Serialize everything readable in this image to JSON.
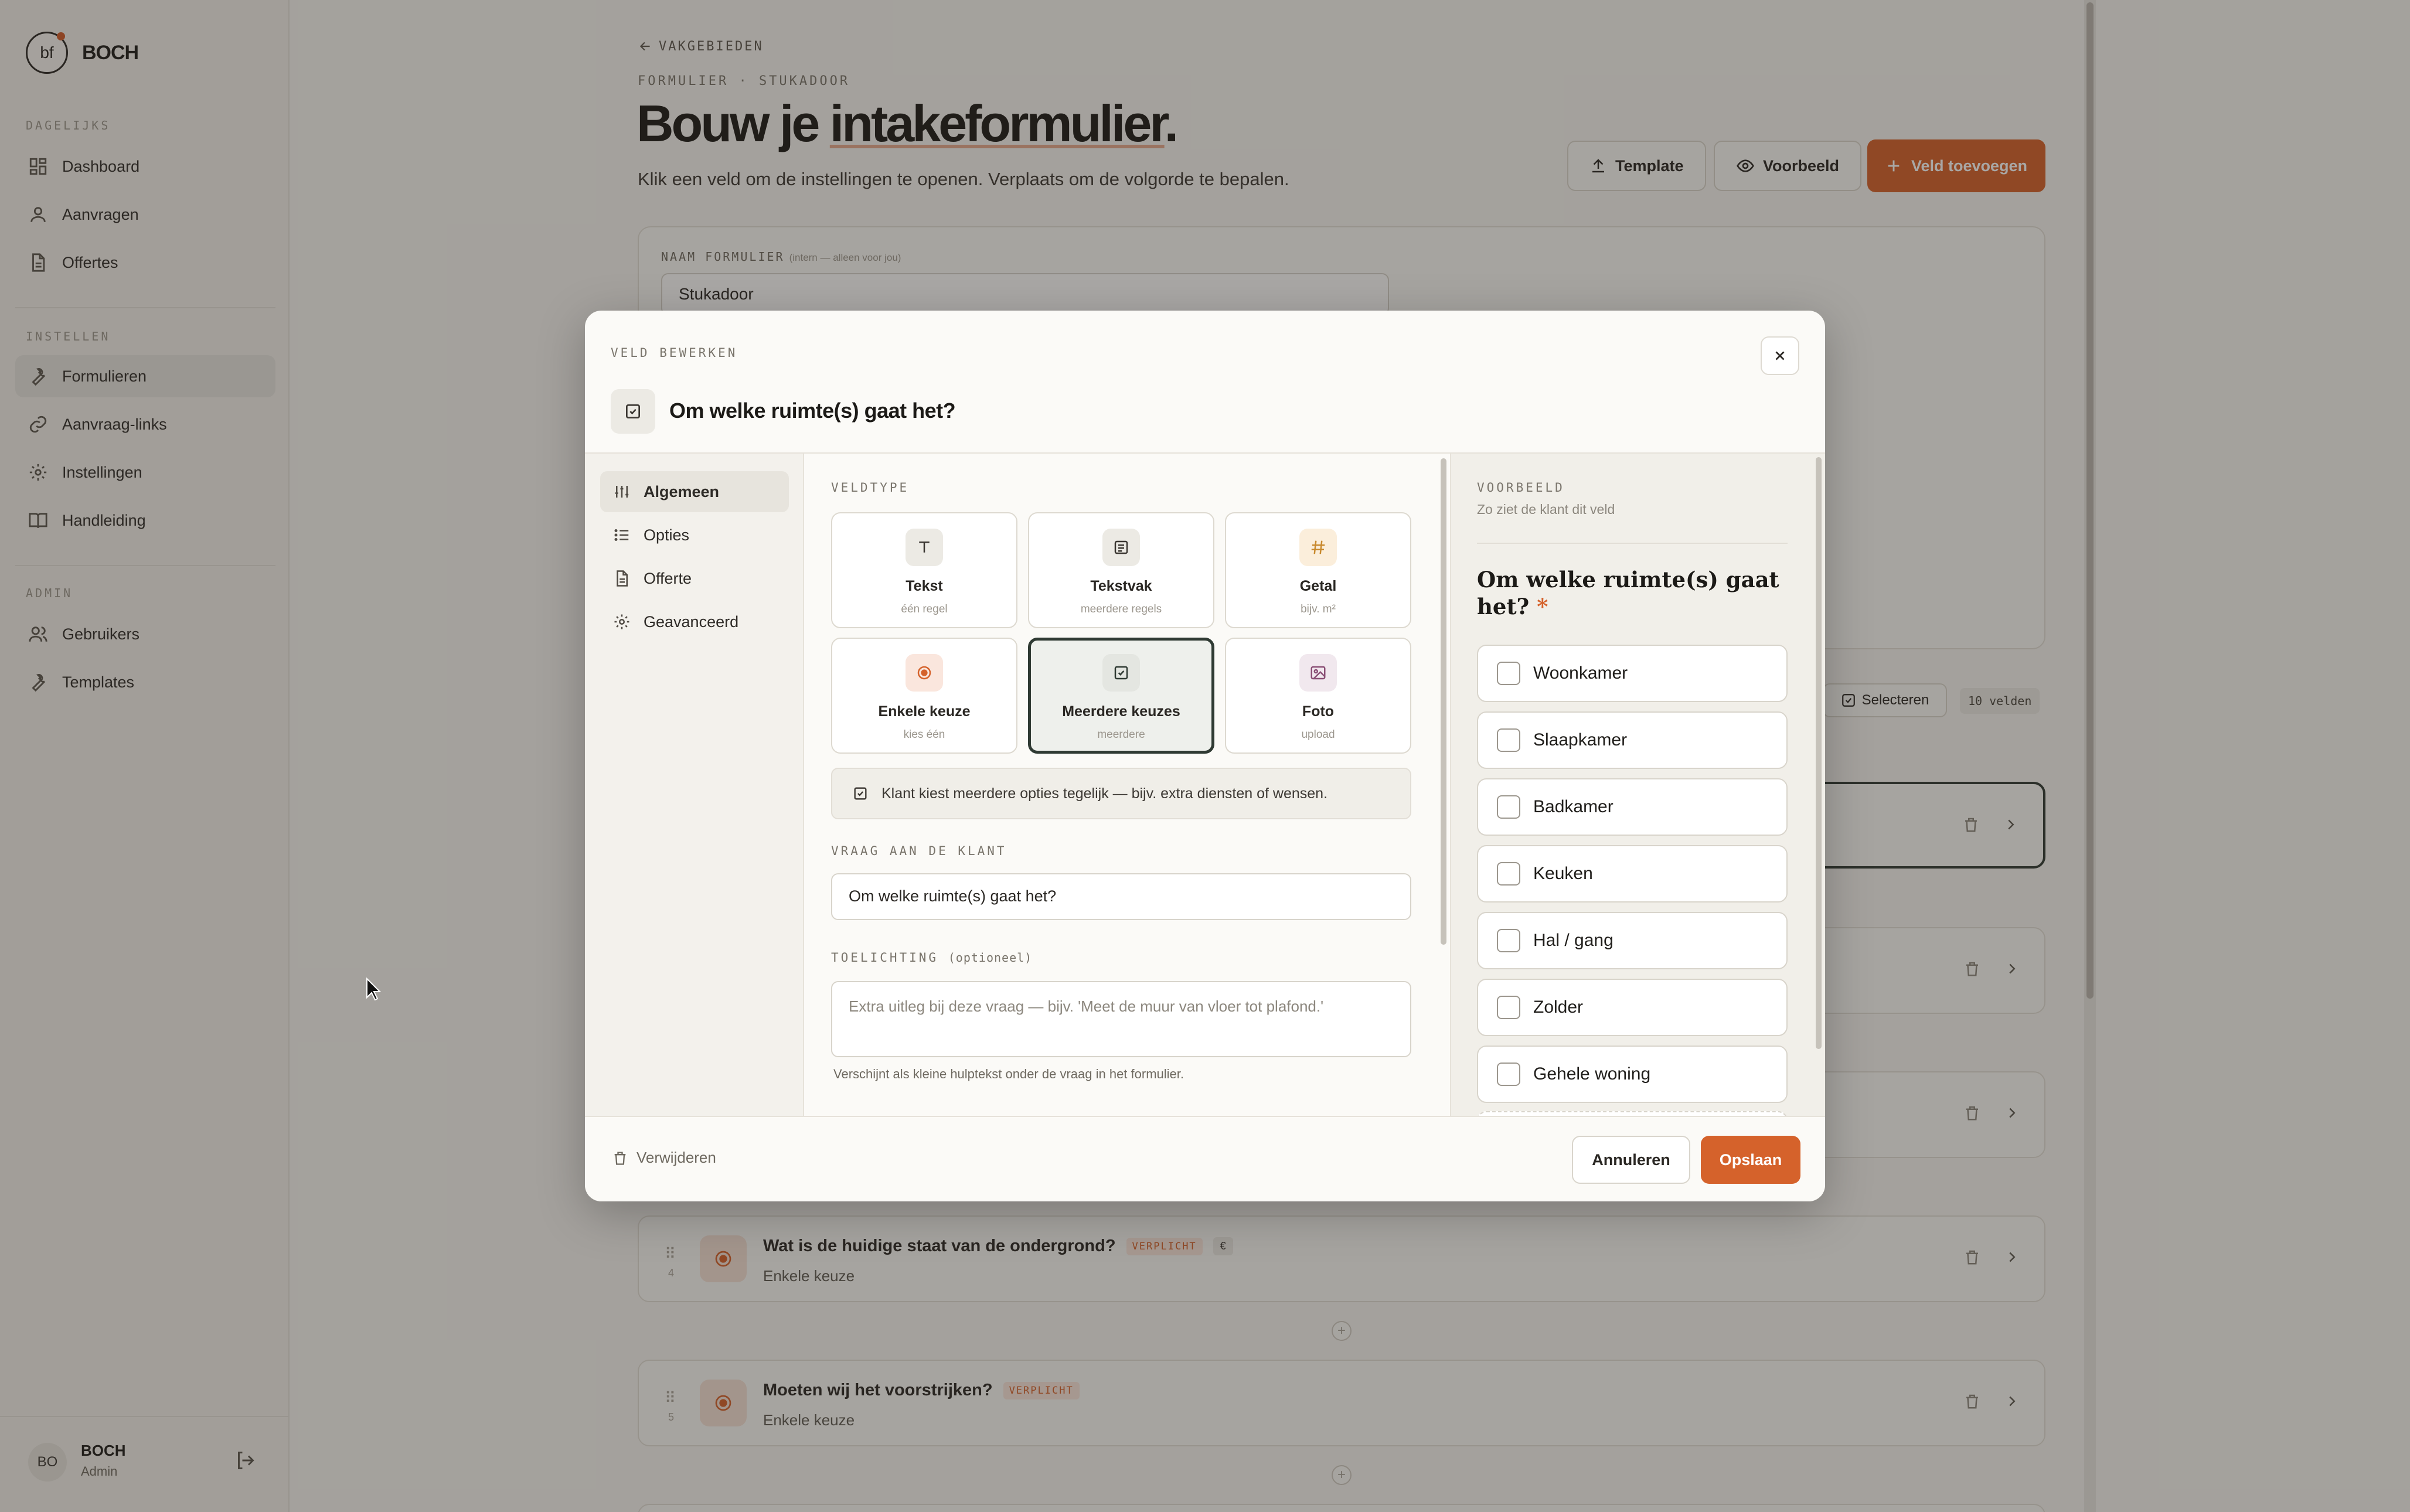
{
  "app": {
    "logo_text": "bf",
    "brand": "BOCH"
  },
  "sidebar": {
    "sections": [
      {
        "label": "DAGELIJKS",
        "items": [
          {
            "label": "Dashboard",
            "icon": "grid-icon"
          },
          {
            "label": "Aanvragen",
            "icon": "user-icon"
          },
          {
            "label": "Offertes",
            "icon": "document-icon"
          }
        ]
      },
      {
        "label": "INSTELLEN",
        "items": [
          {
            "label": "Formulieren",
            "icon": "wrench-icon",
            "active": true
          },
          {
            "label": "Aanvraag-links",
            "icon": "link-icon"
          },
          {
            "label": "Instellingen",
            "icon": "gear-icon"
          },
          {
            "label": "Handleiding",
            "icon": "book-icon"
          }
        ]
      },
      {
        "label": "ADMIN",
        "items": [
          {
            "label": "Gebruikers",
            "icon": "users-icon"
          },
          {
            "label": "Templates",
            "icon": "wrench-icon"
          }
        ]
      }
    ],
    "user": {
      "initials": "BO",
      "name": "BOCH",
      "role": "Admin"
    }
  },
  "header": {
    "back_label": "VAKGEBIEDEN",
    "breadcrumb": "FORMULIER · STUKADOOR",
    "title_part1": "Bouw je ",
    "title_part2": "intakeformulier",
    "title_part3": ".",
    "subtitle": "Klik een veld om de instellingen te openen. Verplaats om de volgorde te bepalen.",
    "template_btn": "Template",
    "preview_btn": "Voorbeeld",
    "add_field_btn": "Veld toevoegen"
  },
  "form_meta": {
    "name_label": "NAAM FORMULIER",
    "name_hint": "(intern — alleen voor jou)",
    "name_value": "Stukadoor",
    "select_btn": "Selecteren",
    "field_count": "10 velden"
  },
  "rows": [
    {
      "num": "4",
      "title": "Wat is de huidige staat van de ondergrond?",
      "badge": "VERPLICHT",
      "currency": "€",
      "type": "Enkele keuze"
    },
    {
      "num": "5",
      "title": "Moeten wij het voorstrijken?",
      "badge": "VERPLICHT",
      "type": "Enkele keuze"
    }
  ],
  "modal": {
    "eyebrow": "VELD BEWERKEN",
    "title": "Om welke ruimte(s) gaat het?",
    "tabs": [
      {
        "label": "Algemeen",
        "icon": "sliders-icon",
        "active": true
      },
      {
        "label": "Opties",
        "icon": "list-icon"
      },
      {
        "label": "Offerte",
        "icon": "document-icon"
      },
      {
        "label": "Geavanceerd",
        "icon": "gear-icon"
      }
    ],
    "fieldtype_label": "VELDTYPE",
    "field_types": [
      {
        "name": "Tekst",
        "sub": "één regel",
        "icon": "text-icon",
        "color": "#eceae4"
      },
      {
        "name": "Tekstvak",
        "sub": "meerdere regels",
        "icon": "textarea-icon",
        "color": "#eceae4"
      },
      {
        "name": "Getal",
        "sub": "bijv. m²",
        "icon": "hash-icon",
        "color": "#fbeedb"
      },
      {
        "name": "Enkele keuze",
        "sub": "kies één",
        "icon": "radio-icon",
        "color": "#fae6dd"
      },
      {
        "name": "Meerdere keuzes",
        "sub": "meerdere",
        "icon": "checkbox-icon",
        "color": "#eceae4",
        "selected": true
      },
      {
        "name": "Foto",
        "sub": "upload",
        "icon": "image-icon",
        "color": "#f1e8ee"
      }
    ],
    "type_info": "Klant kiest meerdere opties tegelijk — bijv. extra diensten of wensen.",
    "question_label": "VRAAG AAN DE KLANT",
    "question_value": "Om welke ruimte(s) gaat het?",
    "explain_label": "TOELICHTING",
    "explain_optional": "(optioneel)",
    "explain_placeholder": "Extra uitleg bij deze vraag — bijv. 'Meet de muur van vloer tot plafond.'",
    "explain_help": "Verschijnt als kleine hulptekst onder de vraag in het formulier.",
    "preview": {
      "label": "VOORBEELD",
      "sub": "Zo ziet de klant dit veld",
      "question": "Om welke ruimte(s) gaat het?",
      "required_mark": "*",
      "options": [
        "Woonkamer",
        "Slaapkamer",
        "Badkamer",
        "Keuken",
        "Hal / gang",
        "Zolder",
        "Gehele woning"
      ]
    },
    "delete_btn": "Verwijderen",
    "cancel_btn": "Annuleren",
    "save_btn": "Opslaan"
  },
  "colors": {
    "accent": "#d5622b",
    "selected_border": "#2f3a33"
  }
}
